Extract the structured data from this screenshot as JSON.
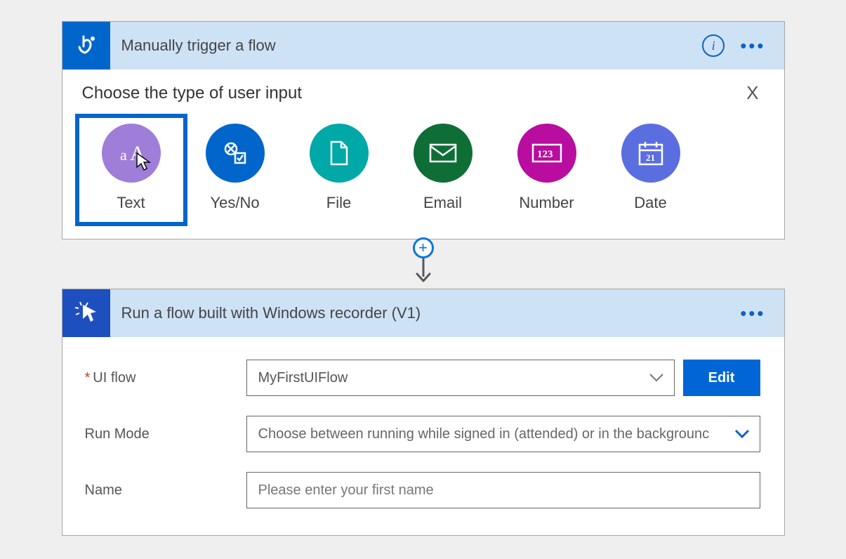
{
  "trigger": {
    "title": "Manually trigger a flow",
    "panel_title": "Choose the type of user input",
    "close_label": "X",
    "types": {
      "text": "Text",
      "yesno": "Yes/No",
      "file": "File",
      "email": "Email",
      "number": "Number",
      "date": "Date"
    }
  },
  "action": {
    "title": "Run a flow built with Windows recorder (V1)",
    "fields": {
      "uiflow": {
        "label": "UI flow",
        "value": "MyFirstUIFlow",
        "edit": "Edit"
      },
      "runmode": {
        "label": "Run Mode",
        "placeholder": "Choose between running while signed in (attended) or in the backgrounc"
      },
      "name": {
        "label": "Name",
        "placeholder": "Please enter your first name"
      }
    }
  }
}
